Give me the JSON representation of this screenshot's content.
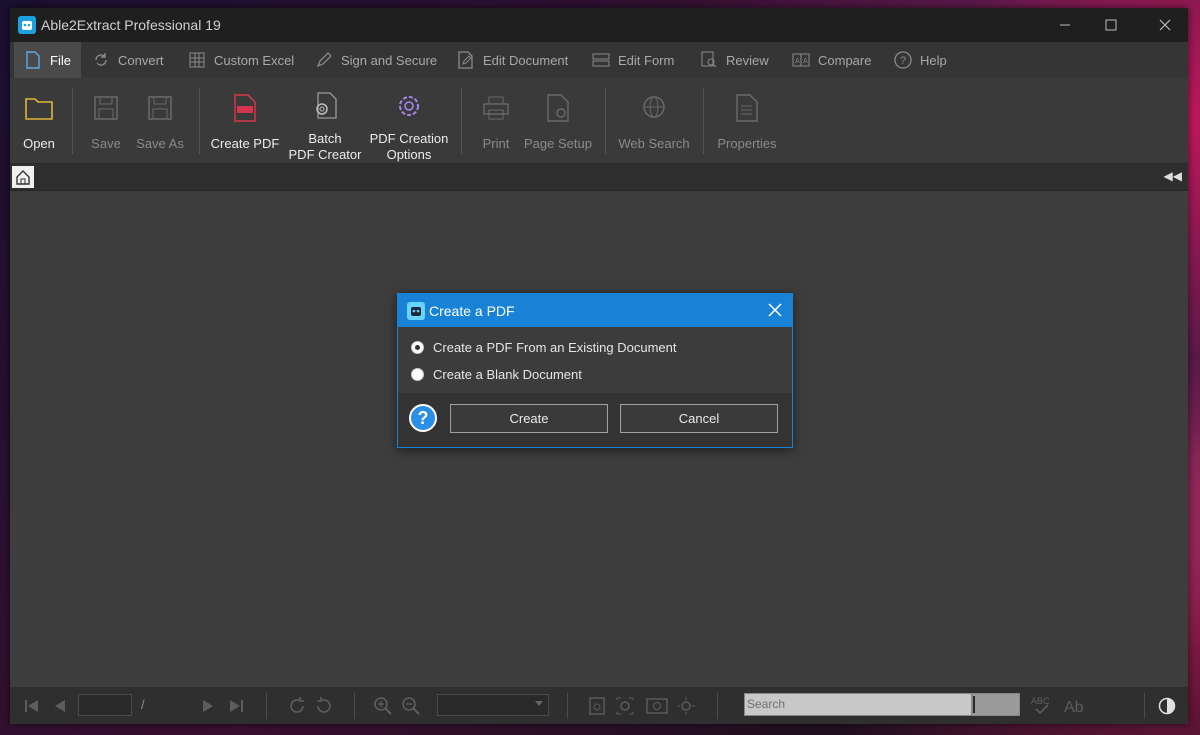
{
  "app": {
    "title": "Able2Extract Professional 19"
  },
  "menu": {
    "items": [
      {
        "label": "File",
        "icon": "file-icon"
      },
      {
        "label": "Convert",
        "icon": "convert-icon"
      },
      {
        "label": "Custom Excel",
        "icon": "grid-icon"
      },
      {
        "label": "Sign and Secure",
        "icon": "pen-icon"
      },
      {
        "label": "Edit Document",
        "icon": "edit-document-icon"
      },
      {
        "label": "Edit Form",
        "icon": "form-icon"
      },
      {
        "label": "Review",
        "icon": "review-icon"
      },
      {
        "label": "Compare",
        "icon": "compare-icon"
      },
      {
        "label": "Help",
        "icon": "help-circle-icon"
      }
    ],
    "active": "File"
  },
  "ribbon": {
    "open": "Open",
    "save": "Save",
    "save_as": "Save As",
    "create_pdf": "Create PDF",
    "batch": "Batch\nPDF Creator",
    "pdf_options": "PDF Creation\nOptions",
    "print": "Print",
    "page_setup": "Page Setup",
    "web_search": "Web Search",
    "properties": "Properties"
  },
  "bottom": {
    "page_value": "",
    "page_separator": "/",
    "search_placeholder": "Search"
  },
  "dialog": {
    "title": "Create a PDF",
    "option_existing": "Create a PDF From an Existing Document",
    "option_blank": "Create a Blank Document",
    "selected": "existing",
    "help_glyph": "?",
    "create_label": "Create",
    "cancel_label": "Cancel"
  },
  "colors": {
    "accent": "#1883d6",
    "folder": "#e0b43a",
    "create_pdf_icon": "#d2364a",
    "gear_icon": "#a487e8"
  }
}
